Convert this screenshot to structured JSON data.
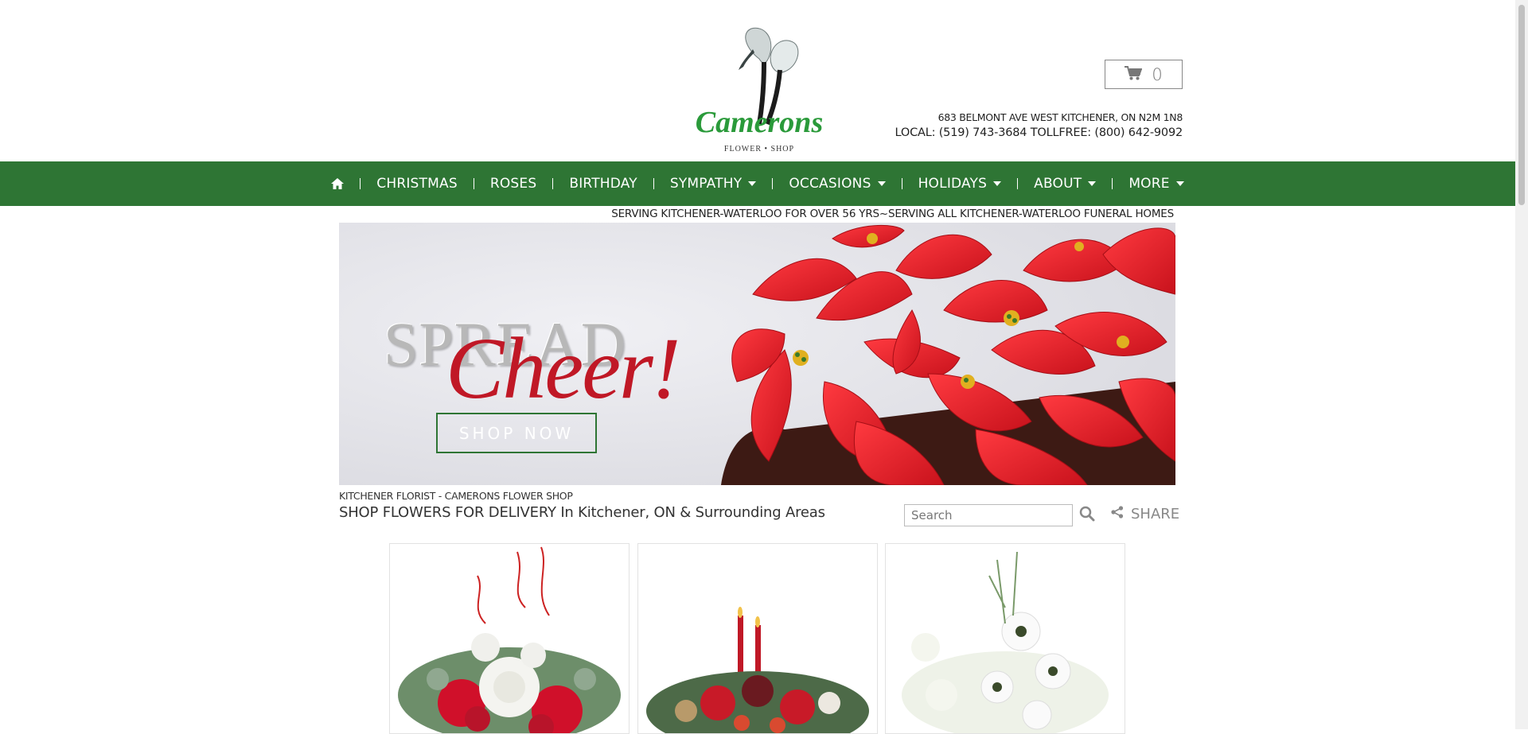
{
  "header": {
    "logo_text": "Camerons",
    "logo_subtext": "FLOWER • SHOP",
    "cart_count": "0",
    "address": "683 BELMONT AVE WEST KITCHENER, ON N2M 1N8",
    "phones": "LOCAL: (519) 743-3684 TOLLFREE: (800) 642-9092"
  },
  "nav": {
    "items": [
      {
        "label": "CHRISTMAS"
      },
      {
        "label": "ROSES"
      },
      {
        "label": "BIRTHDAY"
      },
      {
        "label": "SYMPATHY"
      },
      {
        "label": "OCCASIONS"
      },
      {
        "label": "HOLIDAYS"
      },
      {
        "label": "ABOUT"
      },
      {
        "label": "MORE"
      }
    ]
  },
  "tagline": "SERVING KITCHENER-WATERLOO FOR OVER 56 YRS~SERVING ALL KITCHENER-WATERLOO FUNERAL HOMES",
  "banner": {
    "headline_1": "SPREAD",
    "headline_2": "Cheer!",
    "cta": "SHOP NOW"
  },
  "main": {
    "subtitle": "KITCHENER FLORIST - CAMERONS FLOWER SHOP",
    "title": "SHOP FLOWERS FOR DELIVERY In Kitchener, ON & Surrounding Areas",
    "search_placeholder": "Search",
    "share_label": "SHARE"
  },
  "colors": {
    "brand_green": "#2e7534",
    "poinsettia_red": "#d91f2b",
    "cheer_red": "#c01826"
  },
  "icons": [
    "home-icon",
    "cart-icon",
    "search-icon",
    "share-icon",
    "caret-down-icon"
  ]
}
